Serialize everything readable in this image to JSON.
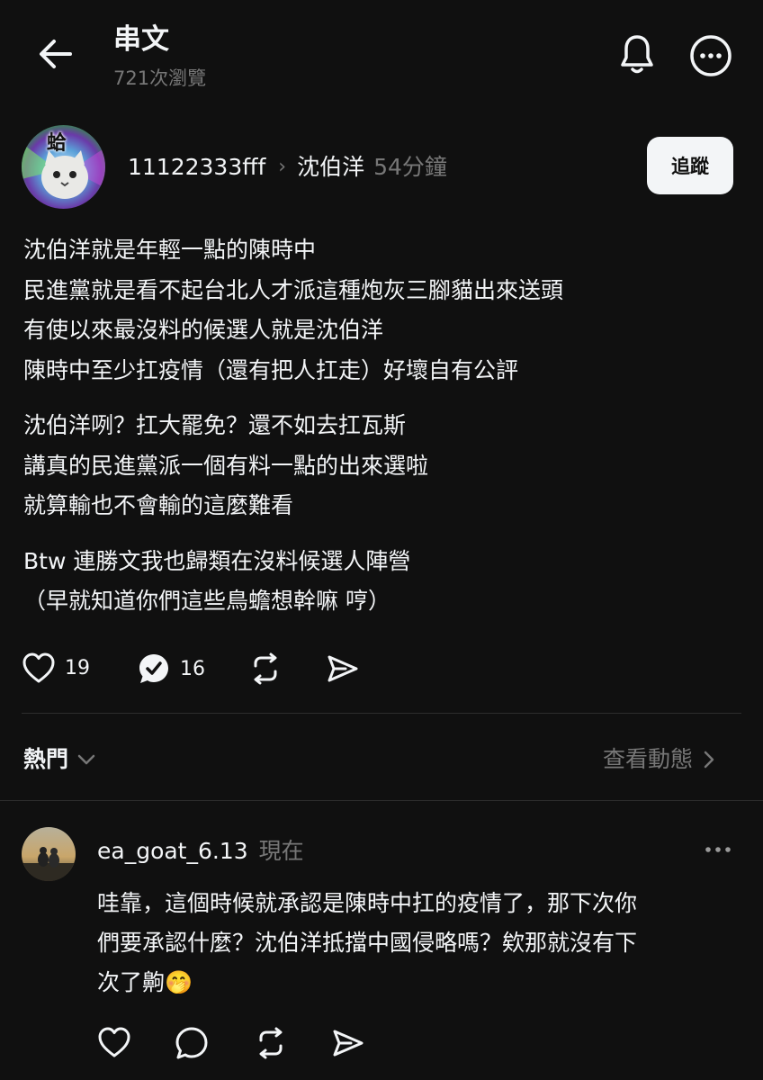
{
  "header": {
    "title": "串文",
    "views": "721次瀏覽"
  },
  "post": {
    "author": "11122333fff",
    "reply_to": "沈伯洋",
    "time": "54分鐘",
    "follow_label": "追蹤",
    "avatar_text": "蛤",
    "paragraphs": [
      [
        "沈伯洋就是年輕一點的陳時中",
        "民進黨就是看不起台北人才派這種炮灰三腳貓出來送頭",
        "有使以來最沒料的候選人就是沈伯洋",
        "陳時中至少扛疫情（還有把人扛走）好壞自有公評"
      ],
      [
        "沈伯洋咧？扛大罷免？還不如去扛瓦斯",
        "講真的民進黨派一個有料一點的出來選啦",
        "就算輸也不會輸的這麼難看"
      ],
      [
        "Btw 連勝文我也歸類在沒料候選人陣營",
        "（早就知道你們這些鳥蟾想幹嘛 哼）"
      ]
    ],
    "likes": "19",
    "replies": "16"
  },
  "filter": {
    "label": "熱門",
    "view_activity": "查看動態"
  },
  "comment": {
    "username": "ea_goat_6.13",
    "time": "現在",
    "lines": [
      "哇靠，這個時候就承認是陳時中扛的疫情了，那下次你",
      "們要承認什麼？沈伯洋抵擋中國侵略嗎？欸那就沒有下",
      "次了齁"
    ],
    "emoji": "🤭"
  },
  "icons": {
    "back": "back-arrow-icon",
    "bell": "bell-icon",
    "more": "more-circle-icon",
    "like": "heart-icon",
    "reply": "reply-bubble-icon",
    "repost": "repost-icon",
    "share": "send-icon"
  }
}
